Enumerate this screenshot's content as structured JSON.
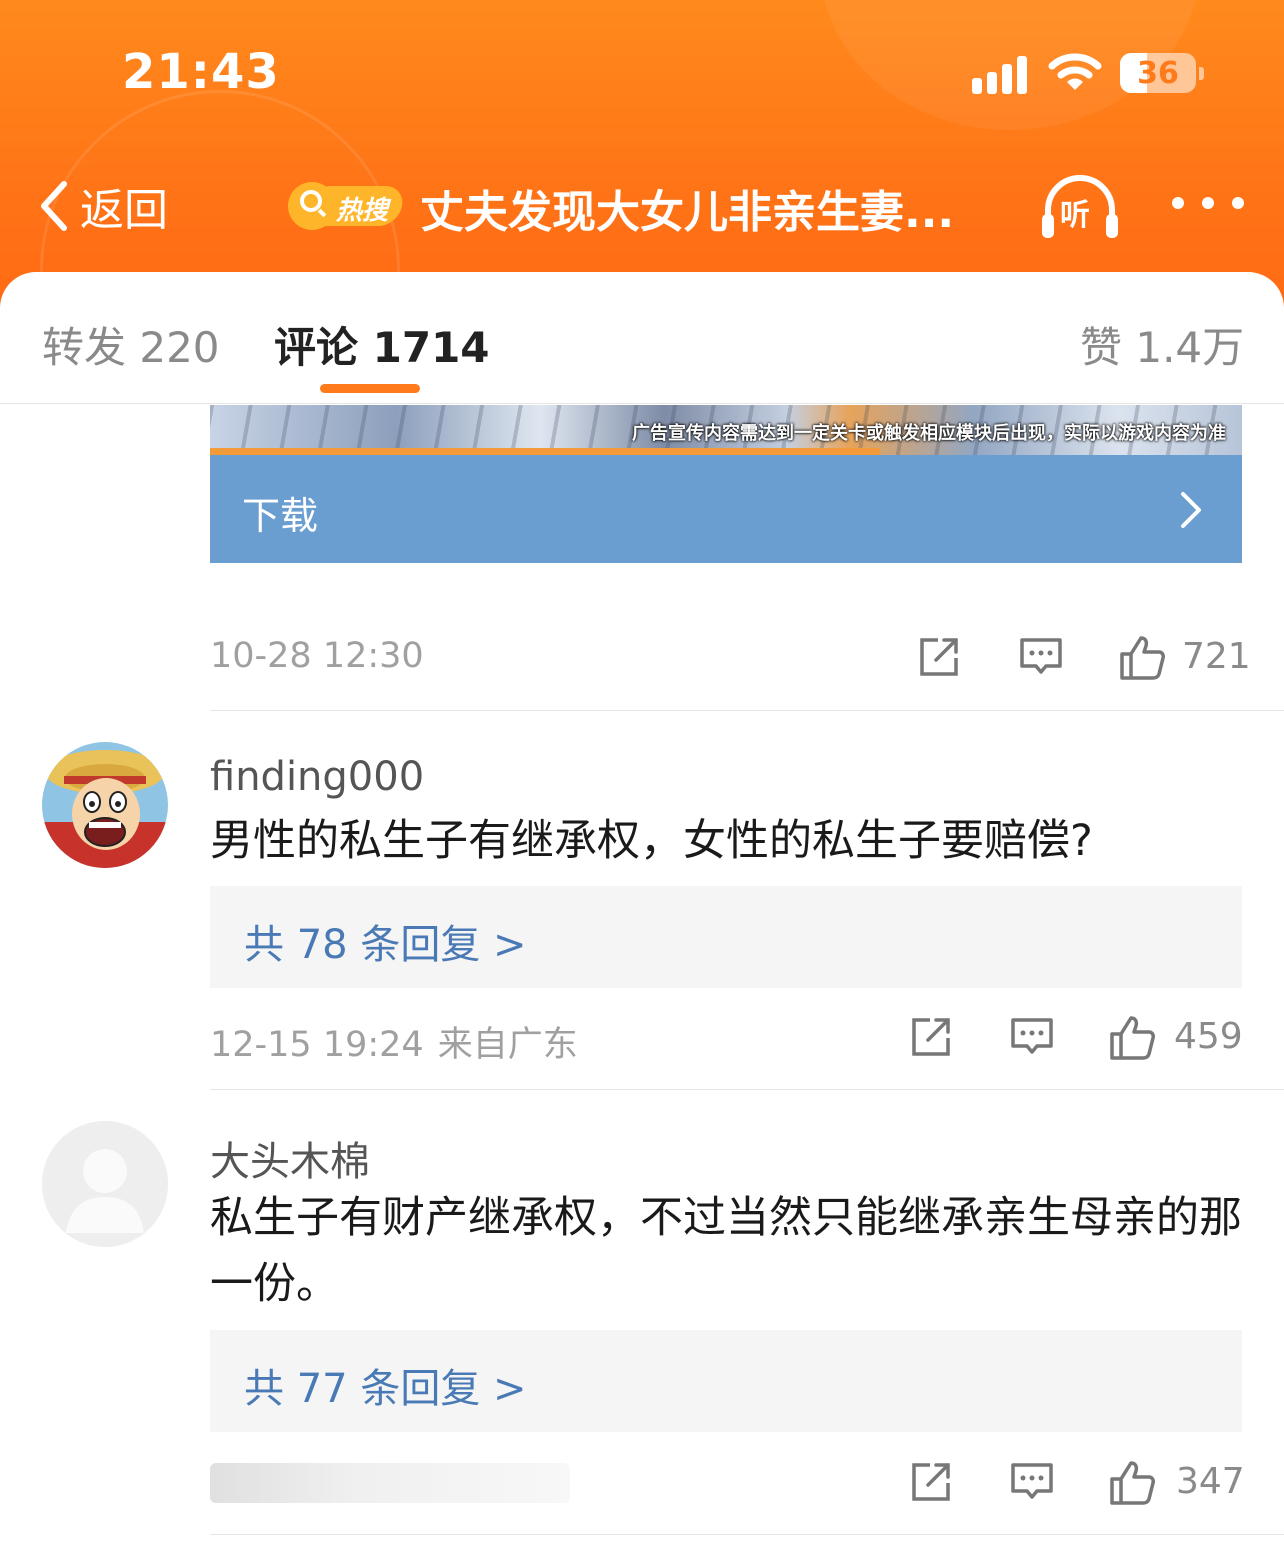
{
  "status_bar": {
    "time": "21:43",
    "battery": "36",
    "battery_level": 0.36
  },
  "nav": {
    "back_label": "返回",
    "hot_tag": "热搜",
    "title": "丈夫发现大女儿非亲生妻...",
    "listen_label": "听"
  },
  "tabs": {
    "repost": "转发 220",
    "comments": "评论 1714",
    "likes": "赞 1.4万"
  },
  "ad": {
    "disclaimer": "广告宣传内容需达到一定关卡或触发相应模块后出现，实际以游戏内容为准",
    "download_label": "下载"
  },
  "post_footer": {
    "timestamp": "10-28 12:30",
    "likes": "721"
  },
  "comments": [
    {
      "username": "finding000",
      "text": "男性的私生子有继承权，女性的私生子要赔偿?",
      "replies": "共 78 条回复 >",
      "timestamp": "12-15 19:24",
      "location": "来自广东",
      "likes": "459"
    },
    {
      "username": "大头木棉",
      "text": "私生子有财产继承权，不过当然只能继承亲生母亲的那一份。",
      "replies": "共 77 条回复 >",
      "likes": "347"
    }
  ],
  "colors": {
    "header_orange": "#ff7a1a",
    "accent": "#ff7a1a",
    "link_blue": "#4a7ab5",
    "ad_button": "#6b9ed0"
  },
  "icons": [
    "chevron-left-icon",
    "search-icon",
    "headphones-icon",
    "more-icon",
    "share-icon",
    "comment-icon",
    "thumbs-up-icon",
    "chevron-right-icon"
  ]
}
